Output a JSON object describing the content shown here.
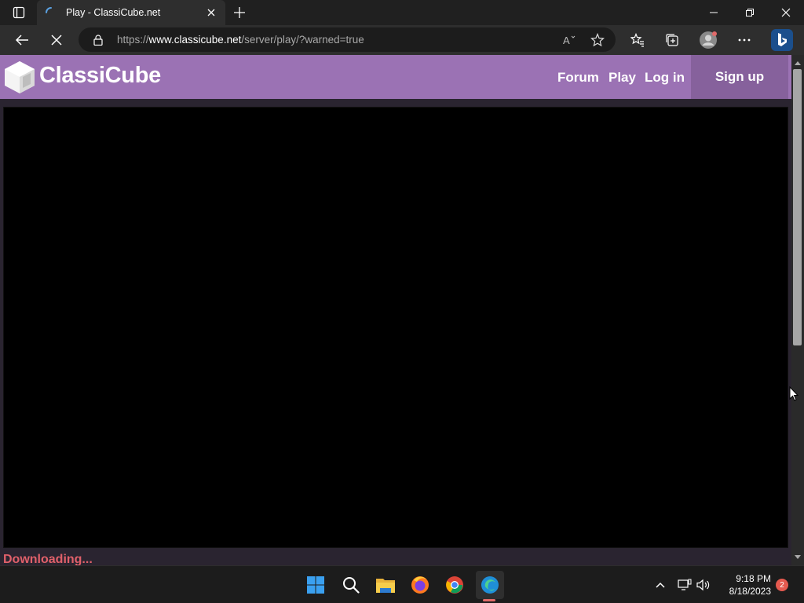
{
  "browser": {
    "tab_title": "Play - ClassiCube.net",
    "url_scheme": "https://",
    "url_host": "www.classicube.net",
    "url_path": "/server/play/?warned=true"
  },
  "site": {
    "brand": "ClassiCube",
    "nav": {
      "forum": "Forum",
      "play": "Play",
      "login": "Log in",
      "signup": "Sign up"
    },
    "status_text": "Downloading..."
  },
  "taskbar": {
    "time": "9:18 PM",
    "date": "8/18/2023",
    "notification_count": "2"
  },
  "colors": {
    "header": "#9b72b4",
    "signup_bg": "#86619c",
    "status": "#e0606a"
  }
}
